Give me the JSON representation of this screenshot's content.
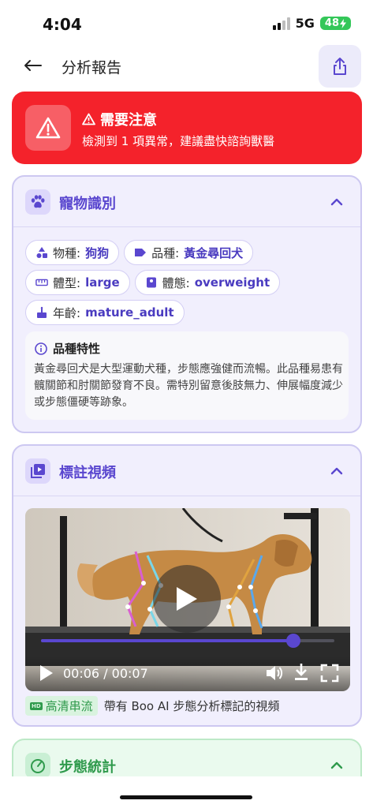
{
  "status_bar": {
    "time": "4:04",
    "network": "5G",
    "battery": "48"
  },
  "header": {
    "title": "分析報告"
  },
  "alert": {
    "title": "需要注意",
    "description": "檢測到 1 項異常，建議盡快諮詢獸醫",
    "color": "#f4222b"
  },
  "pet_card": {
    "title": "寵物識別",
    "chips": [
      {
        "icon": "shapes-icon",
        "label": "物種:",
        "value": "狗狗"
      },
      {
        "icon": "tag-icon",
        "label": "品種:",
        "value": "黃金尋回犬"
      },
      {
        "icon": "ruler-icon",
        "label": "體型:",
        "value": "large"
      },
      {
        "icon": "weight-icon",
        "label": "體態:",
        "value": "overweight"
      },
      {
        "icon": "cake-icon",
        "label": "年齡:",
        "value": "mature_adult"
      }
    ],
    "breed_traits": {
      "title": "品種特性",
      "text": "黃金尋回犬是大型運動犬種，步態應強健而流暢。此品種易患有髖關節和肘關節發育不良。需特別留意後肢無力、伸展幅度減少或步態僵硬等跡象。"
    }
  },
  "video_card": {
    "title": "標註視頻",
    "time_display": "00:06 / 00:07",
    "progress": 0.86,
    "badge": "高清串流",
    "badge_icon_text": "HD",
    "caption": "帶有 Boo AI 步態分析標記的視頻"
  },
  "gait_card": {
    "title": "步態統計"
  },
  "colors": {
    "accent": "#5a47cf",
    "alert": "#f4222b",
    "green": "#2f9a4c"
  }
}
